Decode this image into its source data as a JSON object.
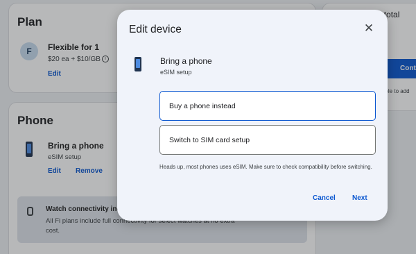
{
  "plan": {
    "title": "Plan",
    "icon": "fi-logo-icon",
    "name": "Flexible for 1",
    "price": "$20 ea + $10/GB",
    "edit_label": "Edit"
  },
  "phone": {
    "title": "Phone",
    "device_name": "Bring a phone",
    "device_sub": "eSIM setup",
    "edit_label": "Edit",
    "remove_label": "Remove",
    "watch": {
      "title": "Watch connectivity inc",
      "body": "All Fi plans include full connectivity for select watches at no extra cost."
    }
  },
  "sidebar": {
    "title": "Monthly subtotal",
    "button_label": "Conti",
    "note_line1": "able to add",
    "note_line2": "t."
  },
  "dialog": {
    "title": "Edit device",
    "close_icon": "close-icon",
    "device_name": "Bring a phone",
    "device_sub": "eSIM setup",
    "option_buy": "Buy a phone instead",
    "option_sim": "Switch to SIM card setup",
    "note": "Heads up, most phones uses eSIM. Make sure to check compatibility before switching.",
    "cancel_label": "Cancel",
    "next_label": "Next"
  },
  "colors": {
    "accent": "#0b57d0",
    "dialog_bg": "#f0f3fa",
    "scrim": "rgba(32,33,36,0.32)"
  }
}
